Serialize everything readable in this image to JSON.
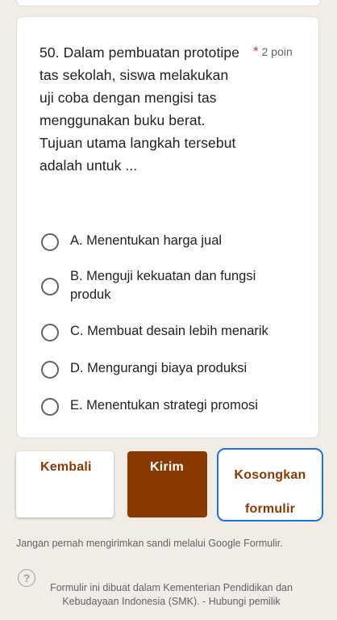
{
  "question": {
    "text": "50. Dalam pembuatan prototipe tas sekolah, siswa melakukan uji coba dengan mengisi tas menggunakan buku berat. Tujuan utama langkah tersebut adalah untuk ...",
    "required_mark": "*",
    "points": "2 poin"
  },
  "options": [
    {
      "label": "A. Menentukan harga jual"
    },
    {
      "label": "B. Menguji kekuatan dan fungsi produk"
    },
    {
      "label": "C. Membuat desain lebih menarik"
    },
    {
      "label": "D. Mengurangi biaya produksi"
    },
    {
      "label": "E. Menentukan strategi promosi"
    }
  ],
  "buttons": {
    "back": "Kembali",
    "submit": "Kirim",
    "clear": "Kosongkan formulir"
  },
  "notice": "Jangan pernah mengirimkan sandi melalui Google Formulir.",
  "footer": {
    "text": "Formulir ini dibuat dalam Kementerian Pendidikan dan Kebudayaan Indonesia (SMK). - ",
    "link": "Hubungi pemilik"
  },
  "colors": {
    "accent": "#8a3a00",
    "focus_border": "#1a73e8",
    "background": "#f1ece6"
  },
  "icons": {
    "help": "help-circle-icon",
    "option": "radio-unchecked-icon"
  }
}
